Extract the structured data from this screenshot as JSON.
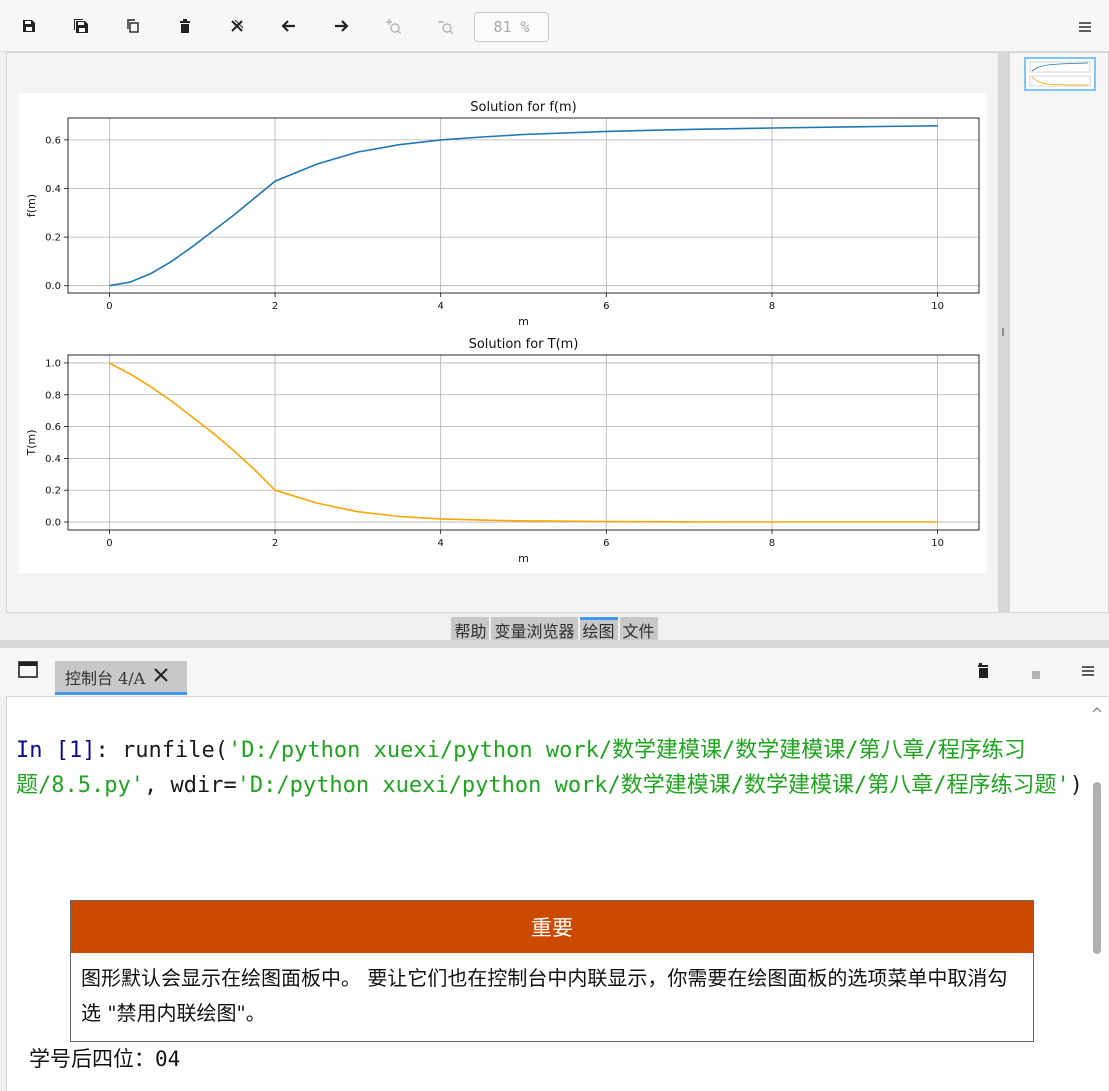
{
  "toolbar": {
    "buttons": [
      {
        "name": "save-icon",
        "glyph": "💾"
      },
      {
        "name": "save-all-icon",
        "glyph": "🗄"
      },
      {
        "name": "copy-icon",
        "glyph": "⧉"
      },
      {
        "name": "delete-icon",
        "glyph": "🗑"
      },
      {
        "name": "delete-all-icon",
        "glyph": "✕"
      },
      {
        "name": "arrow-left-icon",
        "glyph": "←"
      },
      {
        "name": "arrow-right-icon",
        "glyph": "→"
      },
      {
        "name": "zoom-in-icon",
        "glyph": "+"
      },
      {
        "name": "zoom-out-icon",
        "glyph": "-"
      }
    ],
    "zoom": "81 %"
  },
  "chart_data": [
    {
      "type": "line",
      "title": "Solution for f(m)",
      "xlabel": "m",
      "ylabel": "f(m)",
      "xlim": [
        -0.5,
        10.5
      ],
      "ylim": [
        -0.03,
        0.69
      ],
      "xticks": [
        0,
        2,
        4,
        6,
        8,
        10
      ],
      "yticks": [
        0.0,
        0.2,
        0.4,
        0.6
      ],
      "grid": true,
      "color": "#1f77b4",
      "x": [
        0,
        0.25,
        0.5,
        0.75,
        1.0,
        1.25,
        1.5,
        1.75,
        2.0,
        2.5,
        3.0,
        3.5,
        4.0,
        4.5,
        5.0,
        6.0,
        7.0,
        8.0,
        9.0,
        10.0
      ],
      "y": [
        0.0,
        0.015,
        0.05,
        0.1,
        0.16,
        0.225,
        0.29,
        0.36,
        0.43,
        0.5,
        0.55,
        0.58,
        0.6,
        0.612,
        0.622,
        0.635,
        0.643,
        0.649,
        0.654,
        0.658
      ]
    },
    {
      "type": "line",
      "title": "Solution for T(m)",
      "xlabel": "m",
      "ylabel": "T(m)",
      "xlim": [
        -0.5,
        10.5
      ],
      "ylim": [
        -0.05,
        1.05
      ],
      "xticks": [
        0,
        2,
        4,
        6,
        8,
        10
      ],
      "yticks": [
        0.0,
        0.2,
        0.4,
        0.6,
        0.8,
        1.0
      ],
      "grid": true,
      "color": "#ffa500",
      "x": [
        0,
        0.25,
        0.5,
        0.75,
        1.0,
        1.25,
        1.5,
        1.75,
        2.0,
        2.5,
        3.0,
        3.5,
        4.0,
        4.5,
        5.0,
        6.0,
        7.0,
        8.0,
        9.0,
        10.0
      ],
      "y": [
        1.0,
        0.93,
        0.85,
        0.76,
        0.66,
        0.56,
        0.45,
        0.33,
        0.2,
        0.12,
        0.065,
        0.035,
        0.02,
        0.012,
        0.007,
        0.003,
        0.001,
        0.0,
        0.0,
        0.0
      ]
    }
  ],
  "pane_tabs": [
    "帮助",
    "变量浏览器",
    "绘图",
    "文件"
  ],
  "console": {
    "tab_label": "控制台 4/A",
    "prompt": "In [1]",
    "colon": ": ",
    "call_head": "runfile(",
    "arg1": "'D:/python xuexi/python work/数学建模课/数学建模课/第八章/程序练习题/8.5.py'",
    "sep": ", wdir=",
    "arg2": "'D:/python xuexi/python work/数学建模课/数学建模课/第八章/程序练习题'",
    "call_tail": ")",
    "notice_title": "重要",
    "notice_body": "图形默认会显示在绘图面板中。 要让它们也在控制台中内联显示，你需要在绘图面板的选项菜单中取消勾选 \"禁用内联绘图\"。",
    "output_label": "学号后四位：",
    "output_value": "04"
  }
}
